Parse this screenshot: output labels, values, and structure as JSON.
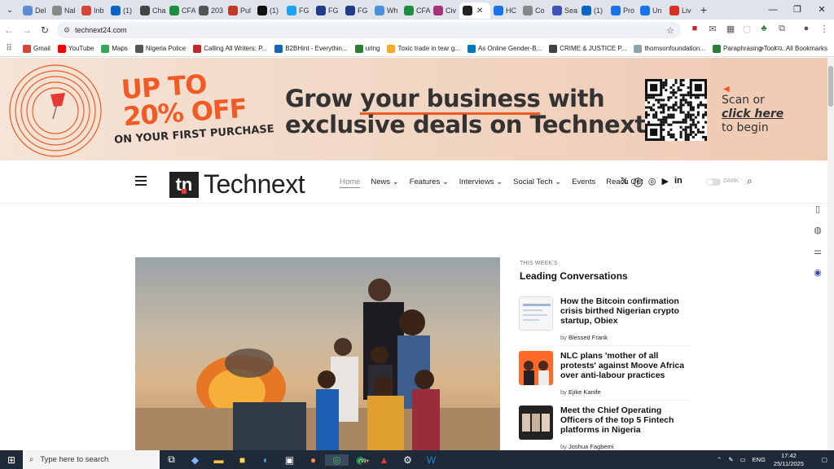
{
  "browser": {
    "tabs": [
      {
        "label": "Del",
        "color": "#5f8dd3"
      },
      {
        "label": "Nal",
        "color": "#888888"
      },
      {
        "label": "Inb",
        "color": "#d44638"
      },
      {
        "label": "(1)",
        "color": "#0a66c2"
      },
      {
        "label": "Cha",
        "color": "#444444"
      },
      {
        "label": "CFA",
        "color": "#1e8e3e"
      },
      {
        "label": "203",
        "color": "#555555"
      },
      {
        "label": "Pul",
        "color": "#c0392b"
      },
      {
        "label": "(1)",
        "color": "#111111"
      },
      {
        "label": "FG",
        "color": "#1da1f2"
      },
      {
        "label": "FG",
        "color": "#1f3c88"
      },
      {
        "label": "FG",
        "color": "#1f3c88"
      },
      {
        "label": "Wh",
        "color": "#4a90d9"
      },
      {
        "label": "CFA",
        "color": "#1e8e3e"
      },
      {
        "label": "Civ",
        "color": "#a83279"
      },
      {
        "label": "",
        "color": "#222222",
        "active": true
      },
      {
        "label": "HC",
        "color": "#1a73e8"
      },
      {
        "label": "Co",
        "color": "#888888"
      },
      {
        "label": "Sea",
        "color": "#3f51b5"
      },
      {
        "label": "(1)",
        "color": "#0a66c2"
      },
      {
        "label": "Pro",
        "color": "#1a73e8"
      },
      {
        "label": "Un",
        "color": "#1a73e8"
      },
      {
        "label": "Liv",
        "color": "#d93025"
      }
    ],
    "url": "technext24.com",
    "bookmarks": [
      {
        "label": "Gmail",
        "color": "#d44638"
      },
      {
        "label": "YouTube",
        "color": "#ff0000"
      },
      {
        "label": "Maps",
        "color": "#34a853"
      },
      {
        "label": "Nigeria Police",
        "color": "#555555"
      },
      {
        "label": "Calling All Writers: P...",
        "color": "#c62828"
      },
      {
        "label": "B2BHint - Everythin...",
        "color": "#1565c0"
      },
      {
        "label": "uring",
        "color": "#2e7d32"
      },
      {
        "label": "Toxic trade in tear g...",
        "color": "#f9a825"
      },
      {
        "label": "As Online Gender-B...",
        "color": "#0277bd"
      },
      {
        "label": "CRIME & JUSTICE P...",
        "color": "#424242"
      },
      {
        "label": "thomsonfoundation...",
        "color": "#90a4ae"
      },
      {
        "label": "Paraphrasing Tool -...",
        "color": "#2e7d32"
      }
    ],
    "all_bookmarks": "All Bookmarks"
  },
  "banner": {
    "promo_line1": "UP TO",
    "promo_line2": "20% OFF",
    "promo_line3": "ON YOUR FIRST PURCHASE",
    "headline_part1": "Grow ",
    "headline_underlined": "your business",
    "headline_part2": " with",
    "headline_line2": "exclusive deals on Technext",
    "scan": "Scan or",
    "click": "click here",
    "begin": "to begin"
  },
  "site": {
    "logo_mark": "tn",
    "logo_text": "Technext",
    "menu": [
      "Home",
      "News ⌄",
      "Features ⌄",
      "Interviews ⌄",
      "Social Tech ⌄",
      "Events",
      "Reach Out"
    ],
    "dark_label": "DARK"
  },
  "leading": {
    "kicker": "THIS WEEK'S",
    "title": "Leading Conversations",
    "articles": [
      {
        "title": "How the Bitcoin confirmation crisis birthed Nigerian crypto startup, Obiex",
        "by": "by",
        "author": "Blessed Frank"
      },
      {
        "title": "NLC plans 'mother of all protests' against Moove Africa over anti-labour practices",
        "by": "by",
        "author": "Ejike Kanife"
      },
      {
        "title": "Meet the Chief Operating Officers of the top 5 Fintech platforms in Nigeria",
        "by": "by",
        "author": "Joshua Fagbemi"
      }
    ]
  },
  "taskbar": {
    "search_placeholder": "Type here to search",
    "lang": "ENG",
    "time": "17:42",
    "date": "25/11/2025",
    "badge": "99+"
  }
}
